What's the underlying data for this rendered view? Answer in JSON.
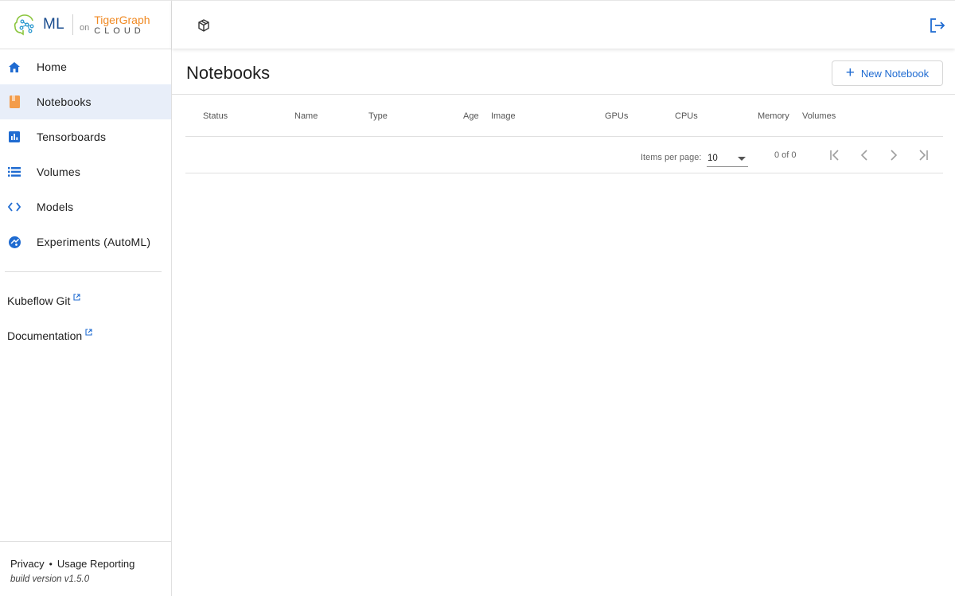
{
  "brand": {
    "product": "ML",
    "on": "on",
    "partner_name": "TigerGraph",
    "partner_sub": "CLOUD"
  },
  "sidebar": {
    "items": [
      {
        "label": "Home",
        "icon": "home-icon",
        "active": false
      },
      {
        "label": "Notebooks",
        "icon": "notebook-icon",
        "active": true
      },
      {
        "label": "Tensorboards",
        "icon": "chart-icon",
        "active": false
      },
      {
        "label": "Volumes",
        "icon": "list-icon",
        "active": false
      },
      {
        "label": "Models",
        "icon": "code-icon",
        "active": false
      },
      {
        "label": "Experiments (AutoML)",
        "icon": "experiment-icon",
        "active": false
      }
    ],
    "external_links": [
      {
        "label": "Kubeflow Git"
      },
      {
        "label": "Documentation"
      }
    ],
    "footer": {
      "privacy": "Privacy",
      "separator": "•",
      "usage": "Usage Reporting",
      "build": "build version v1.5.0"
    }
  },
  "page": {
    "title": "Notebooks",
    "new_button": "New Notebook"
  },
  "table": {
    "columns": [
      "Status",
      "Name",
      "Type",
      "Age",
      "Image",
      "GPUs",
      "CPUs",
      "Memory",
      "Volumes"
    ],
    "rows": []
  },
  "paginator": {
    "items_per_page_label": "Items per page:",
    "items_per_page": "10",
    "range": "0 of 0"
  },
  "colors": {
    "accent": "#1f6bd1",
    "active_bg": "#e8eef9",
    "notebook_icon": "#f39c4a"
  }
}
